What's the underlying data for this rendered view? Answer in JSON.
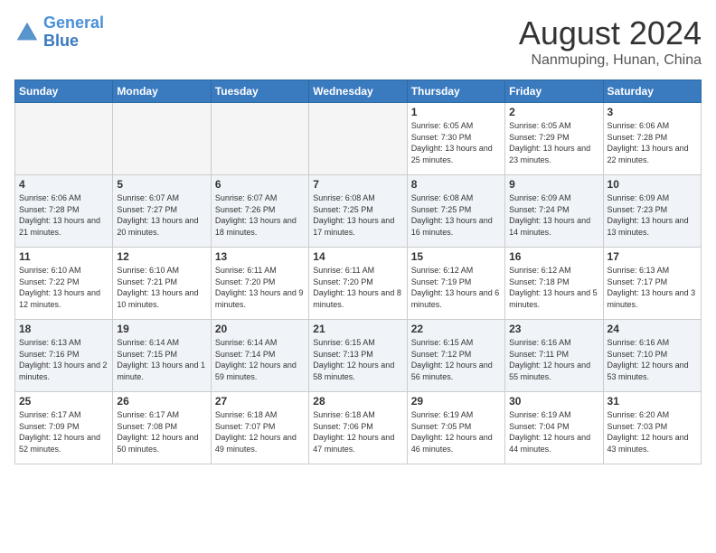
{
  "header": {
    "logo_line1": "General",
    "logo_line2": "Blue",
    "month": "August 2024",
    "location": "Nanmuping, Hunan, China"
  },
  "days_of_week": [
    "Sunday",
    "Monday",
    "Tuesday",
    "Wednesday",
    "Thursday",
    "Friday",
    "Saturday"
  ],
  "weeks": [
    [
      {
        "day": "",
        "empty": true
      },
      {
        "day": "",
        "empty": true
      },
      {
        "day": "",
        "empty": true
      },
      {
        "day": "",
        "empty": true
      },
      {
        "day": "1",
        "sunrise": "6:05 AM",
        "sunset": "7:30 PM",
        "daylight": "13 hours and 25 minutes."
      },
      {
        "day": "2",
        "sunrise": "6:05 AM",
        "sunset": "7:29 PM",
        "daylight": "13 hours and 23 minutes."
      },
      {
        "day": "3",
        "sunrise": "6:06 AM",
        "sunset": "7:28 PM",
        "daylight": "13 hours and 22 minutes."
      }
    ],
    [
      {
        "day": "4",
        "sunrise": "6:06 AM",
        "sunset": "7:28 PM",
        "daylight": "13 hours and 21 minutes."
      },
      {
        "day": "5",
        "sunrise": "6:07 AM",
        "sunset": "7:27 PM",
        "daylight": "13 hours and 20 minutes."
      },
      {
        "day": "6",
        "sunrise": "6:07 AM",
        "sunset": "7:26 PM",
        "daylight": "13 hours and 18 minutes."
      },
      {
        "day": "7",
        "sunrise": "6:08 AM",
        "sunset": "7:25 PM",
        "daylight": "13 hours and 17 minutes."
      },
      {
        "day": "8",
        "sunrise": "6:08 AM",
        "sunset": "7:25 PM",
        "daylight": "13 hours and 16 minutes."
      },
      {
        "day": "9",
        "sunrise": "6:09 AM",
        "sunset": "7:24 PM",
        "daylight": "13 hours and 14 minutes."
      },
      {
        "day": "10",
        "sunrise": "6:09 AM",
        "sunset": "7:23 PM",
        "daylight": "13 hours and 13 minutes."
      }
    ],
    [
      {
        "day": "11",
        "sunrise": "6:10 AM",
        "sunset": "7:22 PM",
        "daylight": "13 hours and 12 minutes."
      },
      {
        "day": "12",
        "sunrise": "6:10 AM",
        "sunset": "7:21 PM",
        "daylight": "13 hours and 10 minutes."
      },
      {
        "day": "13",
        "sunrise": "6:11 AM",
        "sunset": "7:20 PM",
        "daylight": "13 hours and 9 minutes."
      },
      {
        "day": "14",
        "sunrise": "6:11 AM",
        "sunset": "7:20 PM",
        "daylight": "13 hours and 8 minutes."
      },
      {
        "day": "15",
        "sunrise": "6:12 AM",
        "sunset": "7:19 PM",
        "daylight": "13 hours and 6 minutes."
      },
      {
        "day": "16",
        "sunrise": "6:12 AM",
        "sunset": "7:18 PM",
        "daylight": "13 hours and 5 minutes."
      },
      {
        "day": "17",
        "sunrise": "6:13 AM",
        "sunset": "7:17 PM",
        "daylight": "13 hours and 3 minutes."
      }
    ],
    [
      {
        "day": "18",
        "sunrise": "6:13 AM",
        "sunset": "7:16 PM",
        "daylight": "13 hours and 2 minutes."
      },
      {
        "day": "19",
        "sunrise": "6:14 AM",
        "sunset": "7:15 PM",
        "daylight": "13 hours and 1 minute."
      },
      {
        "day": "20",
        "sunrise": "6:14 AM",
        "sunset": "7:14 PM",
        "daylight": "12 hours and 59 minutes."
      },
      {
        "day": "21",
        "sunrise": "6:15 AM",
        "sunset": "7:13 PM",
        "daylight": "12 hours and 58 minutes."
      },
      {
        "day": "22",
        "sunrise": "6:15 AM",
        "sunset": "7:12 PM",
        "daylight": "12 hours and 56 minutes."
      },
      {
        "day": "23",
        "sunrise": "6:16 AM",
        "sunset": "7:11 PM",
        "daylight": "12 hours and 55 minutes."
      },
      {
        "day": "24",
        "sunrise": "6:16 AM",
        "sunset": "7:10 PM",
        "daylight": "12 hours and 53 minutes."
      }
    ],
    [
      {
        "day": "25",
        "sunrise": "6:17 AM",
        "sunset": "7:09 PM",
        "daylight": "12 hours and 52 minutes."
      },
      {
        "day": "26",
        "sunrise": "6:17 AM",
        "sunset": "7:08 PM",
        "daylight": "12 hours and 50 minutes."
      },
      {
        "day": "27",
        "sunrise": "6:18 AM",
        "sunset": "7:07 PM",
        "daylight": "12 hours and 49 minutes."
      },
      {
        "day": "28",
        "sunrise": "6:18 AM",
        "sunset": "7:06 PM",
        "daylight": "12 hours and 47 minutes."
      },
      {
        "day": "29",
        "sunrise": "6:19 AM",
        "sunset": "7:05 PM",
        "daylight": "12 hours and 46 minutes."
      },
      {
        "day": "30",
        "sunrise": "6:19 AM",
        "sunset": "7:04 PM",
        "daylight": "12 hours and 44 minutes."
      },
      {
        "day": "31",
        "sunrise": "6:20 AM",
        "sunset": "7:03 PM",
        "daylight": "12 hours and 43 minutes."
      }
    ]
  ]
}
